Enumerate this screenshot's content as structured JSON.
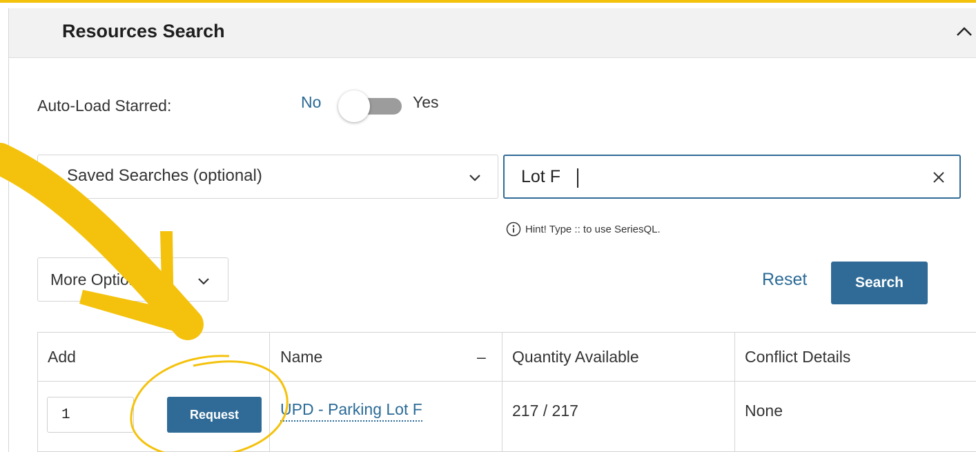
{
  "panel": {
    "title": "Resources Search",
    "collapse_icon": "chevron-up-icon"
  },
  "auto_load": {
    "label": "Auto-Load Starred:",
    "off_label": "No",
    "on_label": "Yes",
    "enabled": false
  },
  "saved_searches": {
    "placeholder": "Saved Searches (optional)",
    "icon": "chevron-down-icon"
  },
  "search_box": {
    "value": "Lot F",
    "clear_icon": "close-icon"
  },
  "hint": {
    "icon": "info-icon",
    "text": "Hint! Type :: to use SeriesQL."
  },
  "more_options": {
    "label": "More Options",
    "icon": "chevron-down-icon"
  },
  "actions": {
    "reset_label": "Reset",
    "search_label": "Search"
  },
  "results": {
    "columns": [
      "Add",
      "Name",
      "Quantity Available",
      "Conflict Details"
    ],
    "sort_indicator": "–",
    "rows": [
      {
        "quantity": "1",
        "request_label": "Request",
        "name": "UPD - Parking Lot F",
        "quantity_available": "217 / 217",
        "conflict_details": "None"
      }
    ]
  },
  "colors": {
    "accent": "#2f6b96",
    "annotation": "#f4c20d",
    "header_bg": "#f2f2f2"
  }
}
